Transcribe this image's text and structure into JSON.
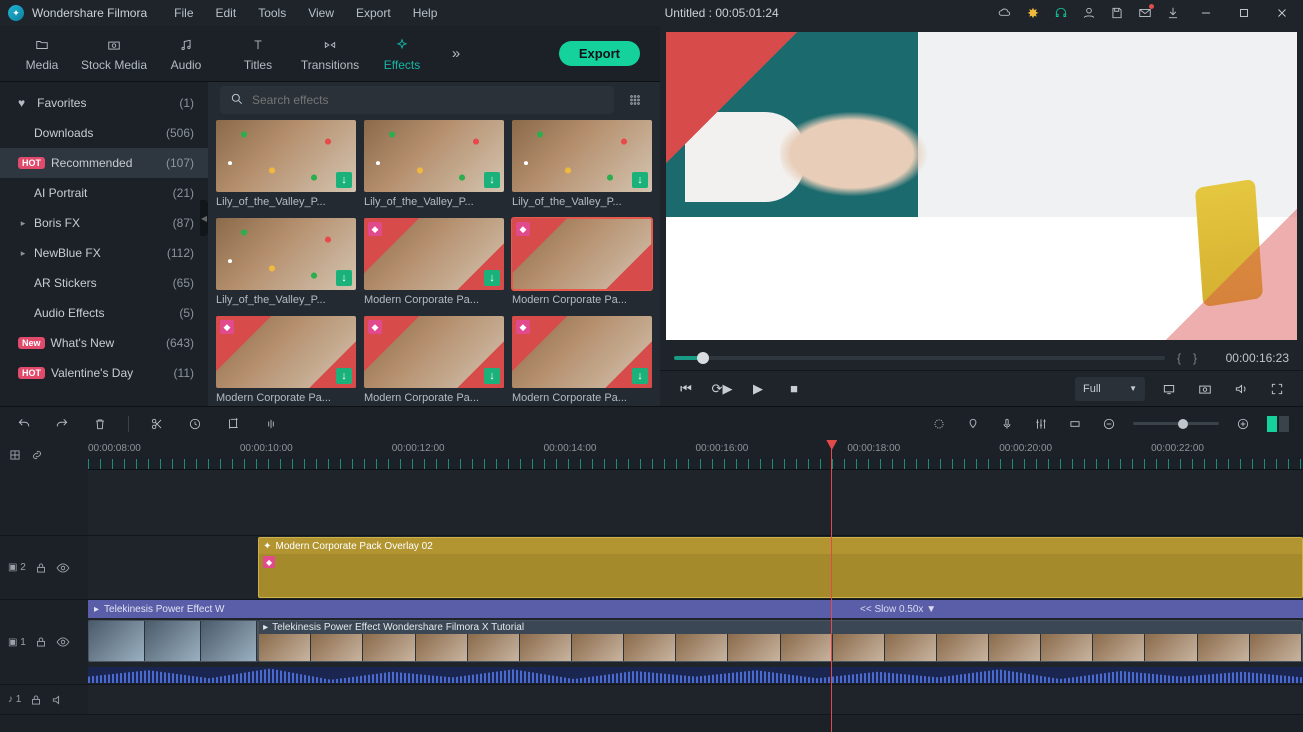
{
  "app_name": "Wondershare Filmora",
  "menus": [
    "File",
    "Edit",
    "Tools",
    "View",
    "Export",
    "Help"
  ],
  "project_title": "Untitled : 00:05:01:24",
  "tabs": [
    {
      "label": "Media"
    },
    {
      "label": "Stock Media"
    },
    {
      "label": "Audio"
    },
    {
      "label": "Titles"
    },
    {
      "label": "Transitions"
    },
    {
      "label": "Effects"
    }
  ],
  "export_label": "Export",
  "search_placeholder": "Search effects",
  "sidebar": [
    {
      "label": "Favorites",
      "count": "(1)",
      "heart": true
    },
    {
      "label": "Downloads",
      "count": "(506)"
    },
    {
      "label": "Recommended",
      "count": "(107)",
      "badge": "HOT",
      "selected": true
    },
    {
      "label": "AI Portrait",
      "count": "(21)"
    },
    {
      "label": "Boris FX",
      "count": "(87)",
      "caret": true
    },
    {
      "label": "NewBlue FX",
      "count": "(112)",
      "caret": true
    },
    {
      "label": "AR Stickers",
      "count": "(65)"
    },
    {
      "label": "Audio Effects",
      "count": "(5)"
    },
    {
      "label": "What's New",
      "count": "(643)",
      "badge": "New"
    },
    {
      "label": "Valentine's Day",
      "count": "(11)",
      "badge": "HOT"
    }
  ],
  "gallery": [
    {
      "name": "Lily_of_the_Valley_P...",
      "variant": "confetti",
      "download": true
    },
    {
      "name": "Lily_of_the_Valley_P...",
      "variant": "confetti",
      "download": true
    },
    {
      "name": "Lily_of_the_Valley_P...",
      "variant": "confetti",
      "download": true
    },
    {
      "name": "Lily_of_the_Valley_P...",
      "variant": "confetti",
      "download": true
    },
    {
      "name": "Modern Corporate Pa...",
      "variant": "corp",
      "gem": true,
      "download": true
    },
    {
      "name": "Modern Corporate Pa...",
      "variant": "corp",
      "gem": true,
      "selected": true
    },
    {
      "name": "Modern Corporate Pa...",
      "variant": "corp",
      "gem": true,
      "download": true
    },
    {
      "name": "Modern Corporate Pa...",
      "variant": "corp",
      "gem": true,
      "download": true
    },
    {
      "name": "Modern Corporate Pa...",
      "variant": "corp",
      "gem": true,
      "download": true
    }
  ],
  "preview": {
    "time": "00:00:16:23",
    "quality": "Full"
  },
  "ruler_labels": [
    "00:00:08:00",
    "00:00:10:00",
    "00:00:12:00",
    "00:00:14:00",
    "00:00:16:00",
    "00:00:18:00",
    "00:00:20:00",
    "00:00:22:00"
  ],
  "tracks": {
    "effect_head": "▣ 2",
    "video_head": "▣ 1",
    "audio_head": "♪ 1",
    "effect_clip": "Modern Corporate Pack Overlay 02",
    "purple_clip": "Telekinesis Power Effect   W",
    "slow_label": "<< Slow 0.50x  ▼",
    "video_clip": "Telekinesis Power Effect   Wondershare Filmora X Tutorial"
  }
}
